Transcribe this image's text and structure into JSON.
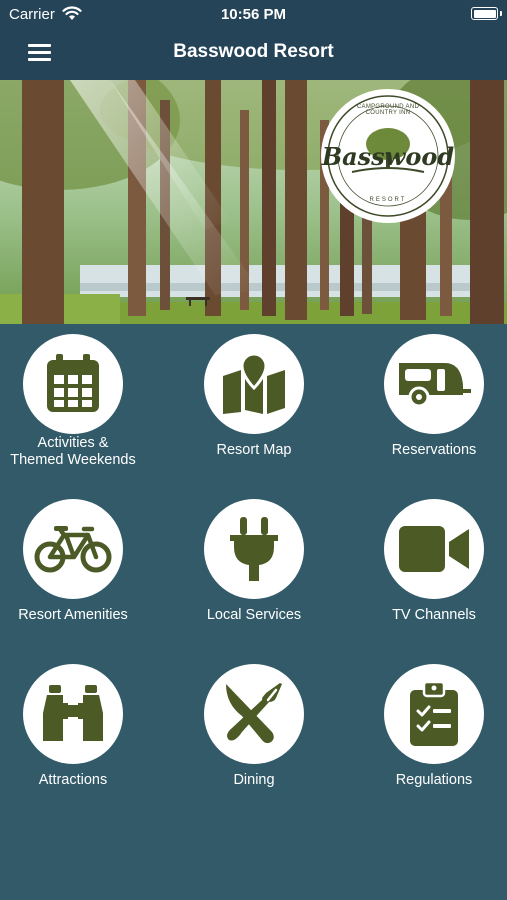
{
  "status_bar": {
    "carrier": "Carrier",
    "time": "10:56 PM"
  },
  "nav": {
    "title": "Basswood Resort"
  },
  "banner": {
    "logo_top_text": "CAMPGROUND AND COUNTRY INN",
    "logo_main_text": "Basswood",
    "logo_bottom_text": "RESORT"
  },
  "tiles": [
    {
      "label": "Activities &\nThemed Weekends",
      "icon": "calendar-icon"
    },
    {
      "label": "Resort Map",
      "icon": "map-icon"
    },
    {
      "label": "Reservations",
      "icon": "camper-trailer-icon"
    },
    {
      "label": "Resort Amenities",
      "icon": "bicycle-icon"
    },
    {
      "label": "Local Services",
      "icon": "plug-icon"
    },
    {
      "label": "TV Channels",
      "icon": "video-camera-icon"
    },
    {
      "label": "Attractions",
      "icon": "binoculars-icon"
    },
    {
      "label": "Dining",
      "icon": "fork-knife-icon"
    },
    {
      "label": "Regulations",
      "icon": "clipboard-checklist-icon"
    }
  ],
  "colors": {
    "background": "#325a69",
    "nav_bar": "#264458",
    "icon_green": "#4c5a26",
    "circle": "#ffffff"
  }
}
